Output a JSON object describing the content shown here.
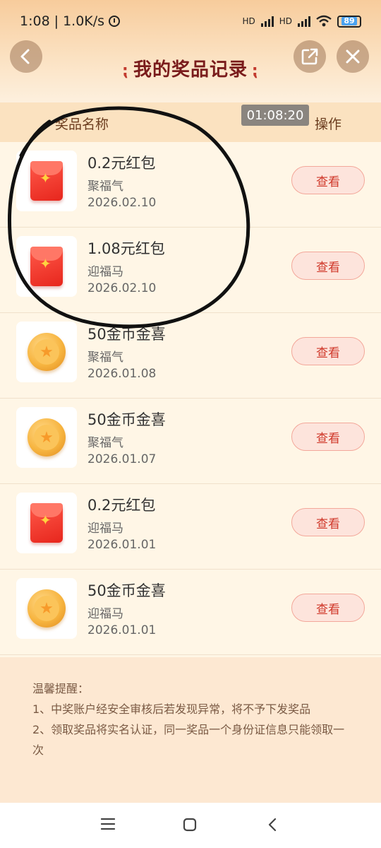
{
  "status_bar": {
    "time": "1:08",
    "speed": "1.0K/s",
    "battery": "89",
    "net1": "HD",
    "net2": "HD"
  },
  "header": {
    "title": "我的奖品记录"
  },
  "table_header": {
    "name_col": "奖品名称",
    "op_col": "操作"
  },
  "timestamp_overlay": "01:08:20",
  "items": [
    {
      "icon": "red-envelope",
      "name": "0.2元红包",
      "sub": "聚福气",
      "date": "2026.02.10",
      "action": "查看"
    },
    {
      "icon": "red-envelope",
      "name": "1.08元红包",
      "sub": "迎福马",
      "date": "2026.02.10",
      "action": "查看"
    },
    {
      "icon": "gold-coin",
      "name": "50金币金喜",
      "sub": "聚福气",
      "date": "2026.01.08",
      "action": "查看"
    },
    {
      "icon": "gold-coin",
      "name": "50金币金喜",
      "sub": "聚福气",
      "date": "2026.01.07",
      "action": "查看"
    },
    {
      "icon": "red-envelope",
      "name": "0.2元红包",
      "sub": "迎福马",
      "date": "2026.01.01",
      "action": "查看"
    },
    {
      "icon": "gold-coin",
      "name": "50金币金喜",
      "sub": "迎福马",
      "date": "2026.01.01",
      "action": "查看"
    }
  ],
  "tips": {
    "heading": "温馨提醒：",
    "line1": "1、中奖账户经安全审核后若发现异常，将不予下发奖品",
    "line2": "2、领取奖品将实名认证，同一奖品一个身份证信息只能领取一次"
  },
  "colors": {
    "accent": "#d0392b",
    "title": "#7a1c1c",
    "background": "#fff6e6"
  }
}
